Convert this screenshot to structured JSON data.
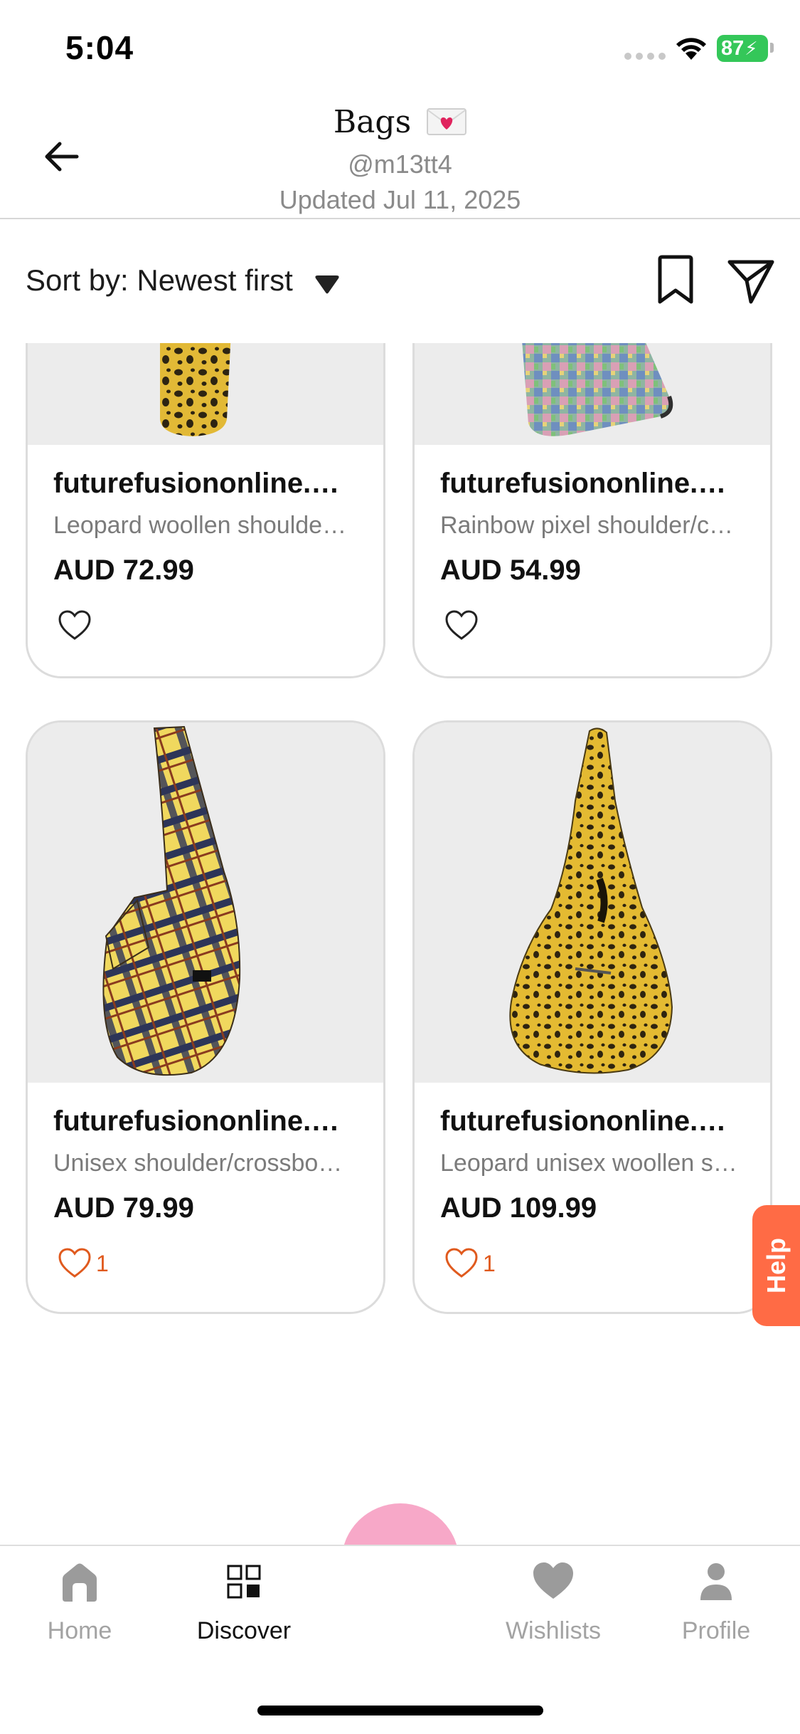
{
  "status_bar": {
    "time": "5:04",
    "battery_percent": "87"
  },
  "header": {
    "title": "Bags",
    "handle": "@m13tt4",
    "updated": "Updated Jul 11, 2025"
  },
  "sort": {
    "label": "Sort by: Newest first"
  },
  "products": [
    {
      "seller": "futurefusiononline.com.au",
      "description": "Leopard woollen shoulder/crossbody bag",
      "price": "AUD 72.99",
      "likes": ""
    },
    {
      "seller": "futurefusiononline.com.au",
      "description": "Rainbow pixel shoulder/crossbody bag",
      "price": "AUD 54.99",
      "likes": ""
    },
    {
      "seller": "futurefusiononline.com.au",
      "description": "Unisex shoulder/crossbody bag",
      "price": "AUD 79.99",
      "likes": "1"
    },
    {
      "seller": "futurefusiononline.com.au",
      "description": "Leopard unisex woollen shoulder bag",
      "price": "AUD 109.99",
      "likes": "1"
    }
  ],
  "help": {
    "label": "Help"
  },
  "nav": {
    "home": "Home",
    "discover": "Discover",
    "wishlists": "Wishlists",
    "profile": "Profile"
  },
  "colors": {
    "accent_orange": "#ff6b45",
    "search_pink": "#f7a8c8",
    "battery_green": "#34c759",
    "like_orange": "#e05a1e"
  }
}
